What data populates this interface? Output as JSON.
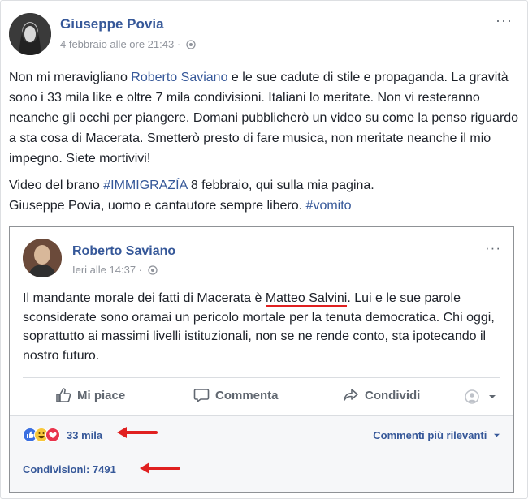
{
  "outer_post": {
    "author": "Giuseppe Povia",
    "timestamp": "4 febbraio alle ore 21:43 ·",
    "more_label": "···",
    "paragraph1": {
      "before_link": "Non mi meravigliano ",
      "link": "Roberto Saviano",
      "after_link": " e le sue cadute di stile e propaganda. La gravità sono i 33 mila like e oltre 7 mila condivisioni. Italiani lo meritate. Non vi resteranno neanche gli occhi per piangere. Domani pubblicherò un video su come la penso riguardo a sta cosa di Macerata. Smetterò presto di fare musica, non meritate neanche il mio impegno. Siete mortivivi!"
    },
    "paragraph2": {
      "before_hashtag": "Video del brano ",
      "hashtag1": "#IMMIGRAZÍA",
      "middle": " 8 febbraio, qui sulla mia pagina.",
      "line2": "Giuseppe Povia, uomo e cantautore sempre libero. ",
      "hashtag2": "#vomito"
    }
  },
  "shared_post": {
    "author": "Roberto Saviano",
    "timestamp": "Ieri alle 14:37 ·",
    "more_label": "···",
    "text_before": "Il mandante morale dei fatti di Macerata è ",
    "underlined": "Matteo Salvini",
    "text_after": ". Lui e le sue parole sconsiderate sono oramai un pericolo mortale per la tenuta democratica. Chi oggi, soprattutto ai massimi livelli istituzionali, non se ne rende conto, sta ipotecando il nostro futuro.",
    "actions": {
      "like": "Mi piace",
      "comment": "Commenta",
      "share": "Condividi"
    },
    "reactions_count": "33 mila",
    "comments_sort": "Commenti più rilevanti",
    "shares_label": "Condivisioni: 7491"
  },
  "icons": {
    "globe": "globe-icon",
    "like": "thumbs-up-icon",
    "comment": "speech-bubble-icon",
    "share": "share-arrow-icon",
    "annotation": "red-arrow-icon"
  },
  "colors": {
    "link": "#365899",
    "annotation": "#e02020",
    "footer_bg": "#f6f7f9"
  }
}
